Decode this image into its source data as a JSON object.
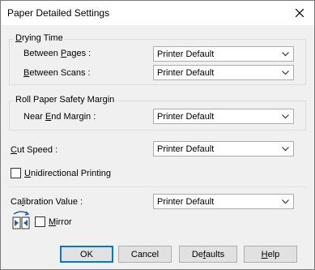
{
  "window": {
    "title": "Paper Detailed Settings"
  },
  "drying_time": {
    "legend": "Drying Time",
    "between_pages_label": "Between Pages :",
    "between_pages_value": "Printer Default",
    "between_scans_label": "Between Scans :",
    "between_scans_value": "Printer Default"
  },
  "roll_margin": {
    "legend": "Roll Paper Safety Margin",
    "near_end_label": "Near End Margin :",
    "near_end_value": "Printer Default"
  },
  "cut_speed": {
    "label": "Cut Speed :",
    "value": "Printer Default"
  },
  "unidirectional": {
    "label": "Unidirectional Printing",
    "checked": false
  },
  "calibration": {
    "label": "Calibration Value :",
    "value": "Printer Default"
  },
  "mirror": {
    "label": "Mirror",
    "checked": false
  },
  "buttons": {
    "ok": "OK",
    "cancel": "Cancel",
    "defaults": "Defaults",
    "help": "Help"
  },
  "colors": {
    "accent": "#0078d7",
    "icon_blue": "#1e5fb4"
  }
}
